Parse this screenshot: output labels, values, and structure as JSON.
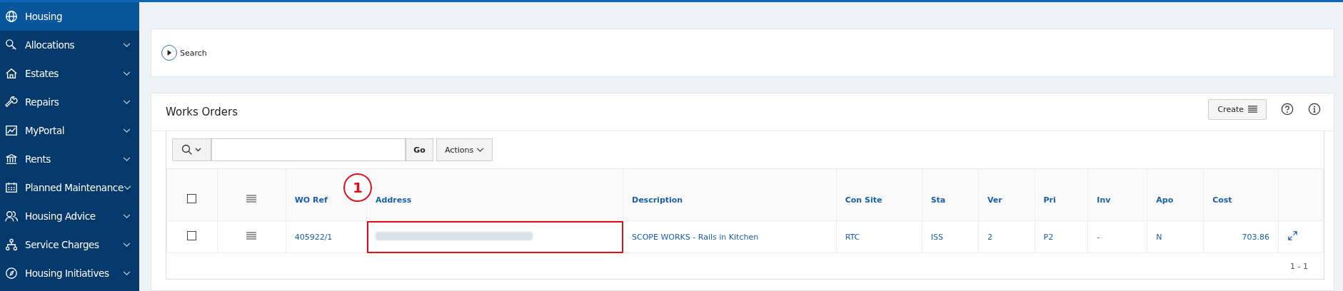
{
  "sidebar": {
    "items": [
      {
        "label": "Housing",
        "selected": true,
        "has_submenu": false
      },
      {
        "label": "Allocations",
        "selected": false,
        "has_submenu": true
      },
      {
        "label": "Estates",
        "selected": false,
        "has_submenu": true
      },
      {
        "label": "Repairs",
        "selected": false,
        "has_submenu": true
      },
      {
        "label": "MyPortal",
        "selected": false,
        "has_submenu": true
      },
      {
        "label": "Rents",
        "selected": false,
        "has_submenu": true
      },
      {
        "label": "Planned Maintenance",
        "selected": false,
        "has_submenu": true
      },
      {
        "label": "Housing Advice",
        "selected": false,
        "has_submenu": true
      },
      {
        "label": "Service Charges",
        "selected": false,
        "has_submenu": true
      },
      {
        "label": "Housing Initiatives",
        "selected": false,
        "has_submenu": true
      }
    ]
  },
  "search_region": {
    "label": "Search",
    "expanded": false
  },
  "works_orders": {
    "title": "Works Orders",
    "create_button": "Create",
    "toolbar": {
      "go_button": "Go",
      "actions_button": "Actions"
    },
    "table": {
      "all_checked": false,
      "columns": [
        "WO Ref",
        "Address",
        "Description",
        "Con Site",
        "Sta",
        "Ver",
        "Pri",
        "Inv",
        "Apo",
        "Cost"
      ],
      "rows": [
        {
          "checked": false,
          "cells": [
            "405922/1",
            "",
            "SCOPE WORKS - Rails in Kitchen",
            "RTC",
            "ISS",
            "2",
            "P2",
            "-",
            "N",
            "703.86"
          ],
          "address_highlighted": true
        }
      ]
    },
    "pagination": "1 - 1"
  },
  "annotation": {
    "number": "1"
  }
}
